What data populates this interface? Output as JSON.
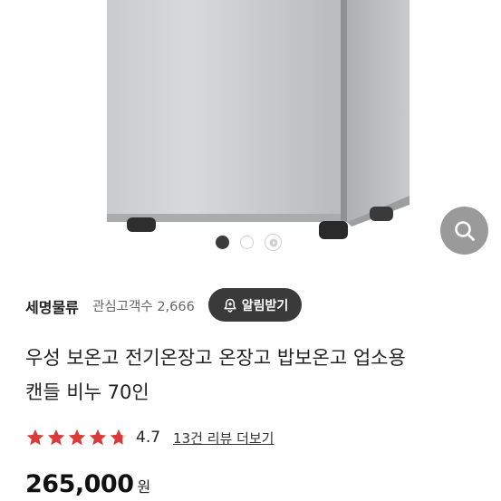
{
  "gallery": {
    "image_alt": "",
    "slides": [
      {
        "type": "image",
        "active": true
      },
      {
        "type": "image",
        "active": false
      },
      {
        "type": "video",
        "active": false
      }
    ],
    "zoom_icon": "search-icon"
  },
  "seller": {
    "name": "세명물류",
    "follow_label": "관심고객수",
    "follow_count": "2,666",
    "alarm_button": "알림받기",
    "alarm_icon": "bell-plus-icon"
  },
  "product": {
    "title_line1": "우성 보온고 전기온장고 온장고 밥보온고 업소용",
    "title_line2": "캔들 비누 70인"
  },
  "rating": {
    "value": "4.7",
    "stars": 4.7,
    "review_link": "13건 리뷰 더보기",
    "star_color": "#d93b3b"
  },
  "price": {
    "amount": "265,000",
    "currency": "원"
  }
}
